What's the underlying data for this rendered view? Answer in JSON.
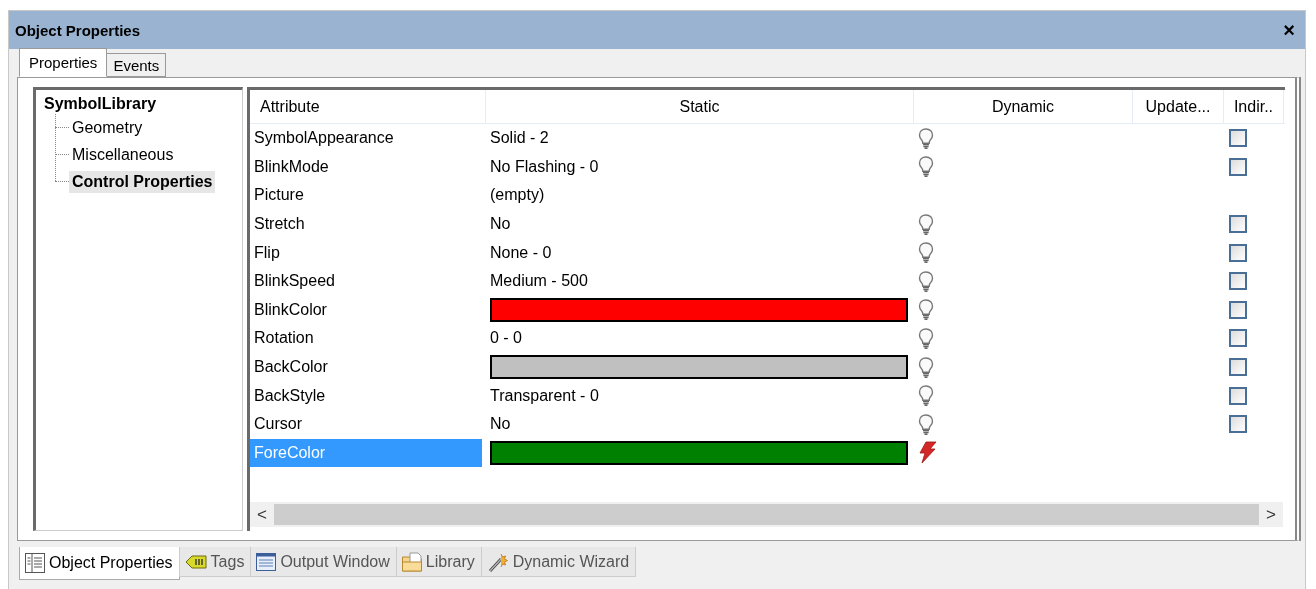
{
  "window": {
    "title": "Object Properties",
    "close": "×"
  },
  "tabs": [
    {
      "label": "Properties",
      "selected": true
    },
    {
      "label": "Events",
      "selected": false
    }
  ],
  "tree": {
    "label": "SymbolLibrary",
    "children": [
      {
        "label": "Geometry",
        "selected": false
      },
      {
        "label": "Miscellaneous",
        "selected": false
      },
      {
        "label": "Control Properties",
        "selected": true
      }
    ]
  },
  "grid": {
    "columns": [
      "Attribute",
      "Static",
      "Dynamic",
      "Update...",
      "Indir.."
    ],
    "rows": [
      {
        "kind": "text",
        "attribute": "SymbolAppearance",
        "static": "Solid - 2",
        "dynamic": {
          "active": false
        },
        "indirect": {
          "checked": false
        },
        "selected": false
      },
      {
        "kind": "text",
        "attribute": "BlinkMode",
        "static": "No Flashing - 0",
        "dynamic": {
          "active": false
        },
        "indirect": {
          "checked": false
        },
        "selected": false
      },
      {
        "kind": "text",
        "attribute": "Picture",
        "static": "(empty)",
        "selected": false
      },
      {
        "kind": "text",
        "attribute": "Stretch",
        "static": "No",
        "dynamic": {
          "active": false
        },
        "indirect": {
          "checked": false
        },
        "selected": false
      },
      {
        "kind": "text",
        "attribute": "Flip",
        "static": "None - 0",
        "dynamic": {
          "active": false
        },
        "indirect": {
          "checked": false
        },
        "selected": false
      },
      {
        "kind": "text",
        "attribute": "BlinkSpeed",
        "static": "Medium - 500",
        "dynamic": {
          "active": false
        },
        "indirect": {
          "checked": false
        },
        "selected": false
      },
      {
        "kind": "color",
        "attribute": "BlinkColor",
        "color": "#ff0000",
        "dynamic": {
          "active": false
        },
        "indirect": {
          "checked": false
        },
        "selected": false
      },
      {
        "kind": "text",
        "attribute": "Rotation",
        "static": "0 - 0",
        "dynamic": {
          "active": false
        },
        "indirect": {
          "checked": false
        },
        "selected": false
      },
      {
        "kind": "color",
        "attribute": "BackColor",
        "color": "#c0c0c0",
        "dynamic": {
          "active": false
        },
        "indirect": {
          "checked": false
        },
        "selected": false
      },
      {
        "kind": "text",
        "attribute": "BackStyle",
        "static": "Transparent - 0",
        "dynamic": {
          "active": false
        },
        "indirect": {
          "checked": false
        },
        "selected": false
      },
      {
        "kind": "text",
        "attribute": "Cursor",
        "static": "No",
        "dynamic": {
          "active": false
        },
        "indirect": {
          "checked": false
        },
        "selected": false
      },
      {
        "kind": "color",
        "attribute": "ForeColor",
        "color": "#008000",
        "dynamic": {
          "active": true
        },
        "selected": true
      }
    ],
    "scroll_left": "<",
    "scroll_right": ">"
  },
  "dock_tabs": [
    {
      "label": "Object Properties",
      "selected": true
    },
    {
      "label": "Tags",
      "selected": false
    },
    {
      "label": "Output Window",
      "selected": false
    },
    {
      "label": "Library",
      "selected": false
    },
    {
      "label": "Dynamic Wizard",
      "selected": false
    }
  ]
}
